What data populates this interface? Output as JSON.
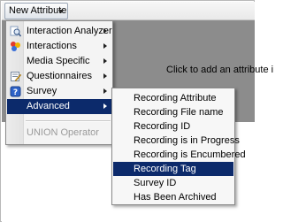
{
  "toolbar": {
    "new_attribute_label": "New Attribute"
  },
  "workspace": {
    "hint_text": "Click to add an attribute i"
  },
  "main_menu": {
    "items": [
      {
        "label": "Interaction Analyzer",
        "icon": "magnifier-icon"
      },
      {
        "label": "Interactions",
        "icon": "interactions-icon"
      },
      {
        "label": "Media Specific",
        "icon": ""
      },
      {
        "label": "Questionnaires",
        "icon": "questionnaire-icon"
      },
      {
        "label": "Survey",
        "icon": "survey-help-icon"
      },
      {
        "label": "Advanced",
        "icon": ""
      },
      {
        "label": "UNION Operator",
        "icon": ""
      }
    ]
  },
  "advanced_submenu": {
    "items": [
      "Recording Attribute",
      "Recording File name",
      "Recording ID",
      "Recording is in Progress",
      "Recording is Encumbered",
      "Recording Tag",
      "Survey ID",
      "Has Been Archived"
    ],
    "highlighted": "Recording Tag"
  },
  "colors": {
    "highlight": "#0c2a6b",
    "workspace_gray": "#8c8c8c"
  }
}
